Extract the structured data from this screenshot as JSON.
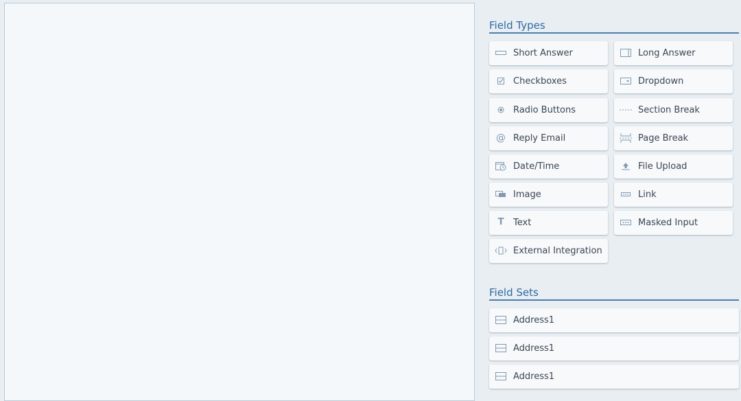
{
  "field_types": {
    "title": "Field Types",
    "items": [
      {
        "label": "Short Answer",
        "icon": "short-answer-icon"
      },
      {
        "label": "Long Answer",
        "icon": "long-answer-icon"
      },
      {
        "label": "Checkboxes",
        "icon": "checkbox-icon"
      },
      {
        "label": "Dropdown",
        "icon": "dropdown-icon"
      },
      {
        "label": "Radio Buttons",
        "icon": "radio-button-icon"
      },
      {
        "label": "Section Break",
        "icon": "section-break-icon"
      },
      {
        "label": "Reply Email",
        "icon": "at-sign-icon"
      },
      {
        "label": "Page Break",
        "icon": "page-break-icon"
      },
      {
        "label": "Date/Time",
        "icon": "calendar-clock-icon"
      },
      {
        "label": "File Upload",
        "icon": "upload-icon"
      },
      {
        "label": "Image",
        "icon": "image-icon"
      },
      {
        "label": "Link",
        "icon": "link-icon"
      },
      {
        "label": "Text",
        "icon": "text-icon"
      },
      {
        "label": "Masked Input",
        "icon": "masked-input-icon"
      },
      {
        "label": "External Integration",
        "icon": "external-integration-icon"
      }
    ]
  },
  "field_sets": {
    "title": "Field Sets",
    "items": [
      {
        "label": "Address1",
        "icon": "address-set-icon"
      },
      {
        "label": "Address1",
        "icon": "address-set-icon"
      },
      {
        "label": "Address1",
        "icon": "address-set-icon"
      }
    ]
  },
  "colors": {
    "accent": "#2b6ba8",
    "icon": "#7f9ab4",
    "panel_background": "#e9eef2",
    "canvas_background": "#f5f8fa"
  }
}
